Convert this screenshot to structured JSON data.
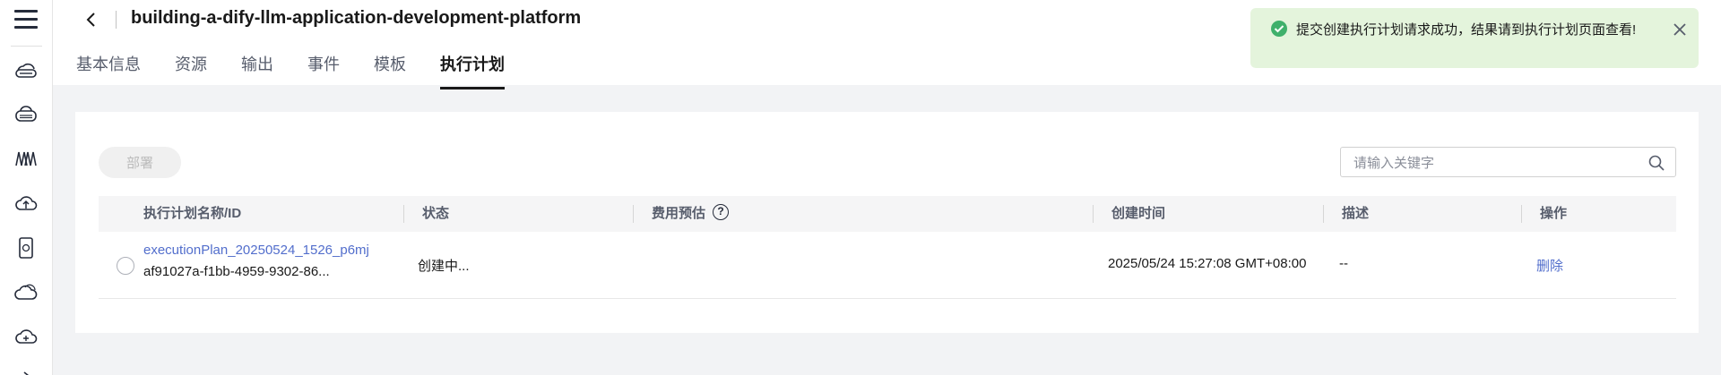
{
  "app": {
    "title": "building-a-dify-llm-application-development-platform"
  },
  "sidebar": {
    "icons": [
      "cloud-server-icon",
      "cloud-database-icon",
      "waves-icon",
      "cloud-upload-icon",
      "device-icon",
      "cloud-layers-icon",
      "cloud-network-icon"
    ]
  },
  "tabs": [
    {
      "label": "基本信息",
      "active": false
    },
    {
      "label": "资源",
      "active": false
    },
    {
      "label": "输出",
      "active": false
    },
    {
      "label": "事件",
      "active": false
    },
    {
      "label": "模板",
      "active": false
    },
    {
      "label": "执行计划",
      "active": true
    }
  ],
  "toolbar": {
    "deploy_label": "部署",
    "search_placeholder": "请输入关键字"
  },
  "table": {
    "columns": {
      "name": "执行计划名称/ID",
      "status": "状态",
      "cost": "费用预估",
      "created": "创建时间",
      "description": "描述",
      "actions": "操作"
    },
    "rows": [
      {
        "name": "executionPlan_20250524_1526_p6mj",
        "id": "af91027a-f1bb-4959-9302-86...",
        "status": "创建中...",
        "created": "2025/05/24 15:27:08 GMT+08:00",
        "description": "--",
        "action": "删除"
      }
    ]
  },
  "toast": {
    "message": "提交创建执行计划请求成功，结果请到执行计划页面查看!"
  },
  "colors": {
    "link": "#526ecc",
    "success": "#3fb06b",
    "toast_bg": "#e4f4dc"
  }
}
